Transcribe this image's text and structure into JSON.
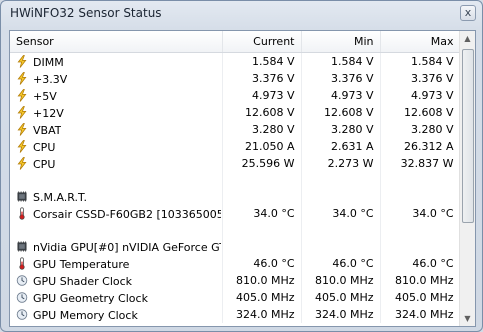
{
  "window": {
    "title": "HWiNFO32 Sensor Status",
    "close_glyph": "x"
  },
  "columns": [
    "Sensor",
    "Current",
    "Min",
    "Max"
  ],
  "scrollbar": {
    "up_glyph": "▲",
    "down_glyph": "▼"
  },
  "rows": [
    {
      "type": "sensor",
      "icon": "bolt-icon",
      "name": "DIMM",
      "current": "1.584 V",
      "min": "1.584 V",
      "max": "1.584 V"
    },
    {
      "type": "sensor",
      "icon": "bolt-icon",
      "name": "+3.3V",
      "current": "3.376 V",
      "min": "3.376 V",
      "max": "3.376 V"
    },
    {
      "type": "sensor",
      "icon": "bolt-icon",
      "name": "+5V",
      "current": "4.973 V",
      "min": "4.973 V",
      "max": "4.973 V"
    },
    {
      "type": "sensor",
      "icon": "bolt-icon",
      "name": "+12V",
      "current": "12.608 V",
      "min": "12.608 V",
      "max": "12.608 V"
    },
    {
      "type": "sensor",
      "icon": "bolt-icon",
      "name": "VBAT",
      "current": "3.280 V",
      "min": "3.280 V",
      "max": "3.280 V"
    },
    {
      "type": "sensor",
      "icon": "bolt-icon",
      "name": "CPU",
      "current": "21.050 A",
      "min": "2.631 A",
      "max": "26.312 A"
    },
    {
      "type": "sensor",
      "icon": "bolt-icon",
      "name": "CPU",
      "current": "25.596 W",
      "min": "2.273 W",
      "max": "32.837 W"
    },
    {
      "type": "gap"
    },
    {
      "type": "group",
      "icon": "chip-icon",
      "name": "S.M.A.R.T."
    },
    {
      "type": "sensor",
      "icon": "thermometer-icon",
      "name": "Corsair CSSD-F60GB2 [1033650059...",
      "current": "34.0 °C",
      "min": "34.0 °C",
      "max": "34.0 °C"
    },
    {
      "type": "gap"
    },
    {
      "type": "group",
      "icon": "chip-icon",
      "name": "nVidia GPU[#0] nVIDIA GeForce GT..."
    },
    {
      "type": "sensor",
      "icon": "thermometer-icon",
      "name": "GPU Temperature",
      "current": "46.0 °C",
      "min": "46.0 °C",
      "max": "46.0 °C"
    },
    {
      "type": "sensor",
      "icon": "clock-icon",
      "name": "GPU Shader Clock",
      "current": "810.0 MHz",
      "min": "810.0 MHz",
      "max": "810.0 MHz"
    },
    {
      "type": "sensor",
      "icon": "clock-icon",
      "name": "GPU Geometry Clock",
      "current": "405.0 MHz",
      "min": "405.0 MHz",
      "max": "405.0 MHz"
    },
    {
      "type": "sensor",
      "icon": "clock-icon",
      "name": "GPU Memory Clock",
      "current": "324.0 MHz",
      "min": "324.0 MHz",
      "max": "324.0 MHz"
    }
  ]
}
